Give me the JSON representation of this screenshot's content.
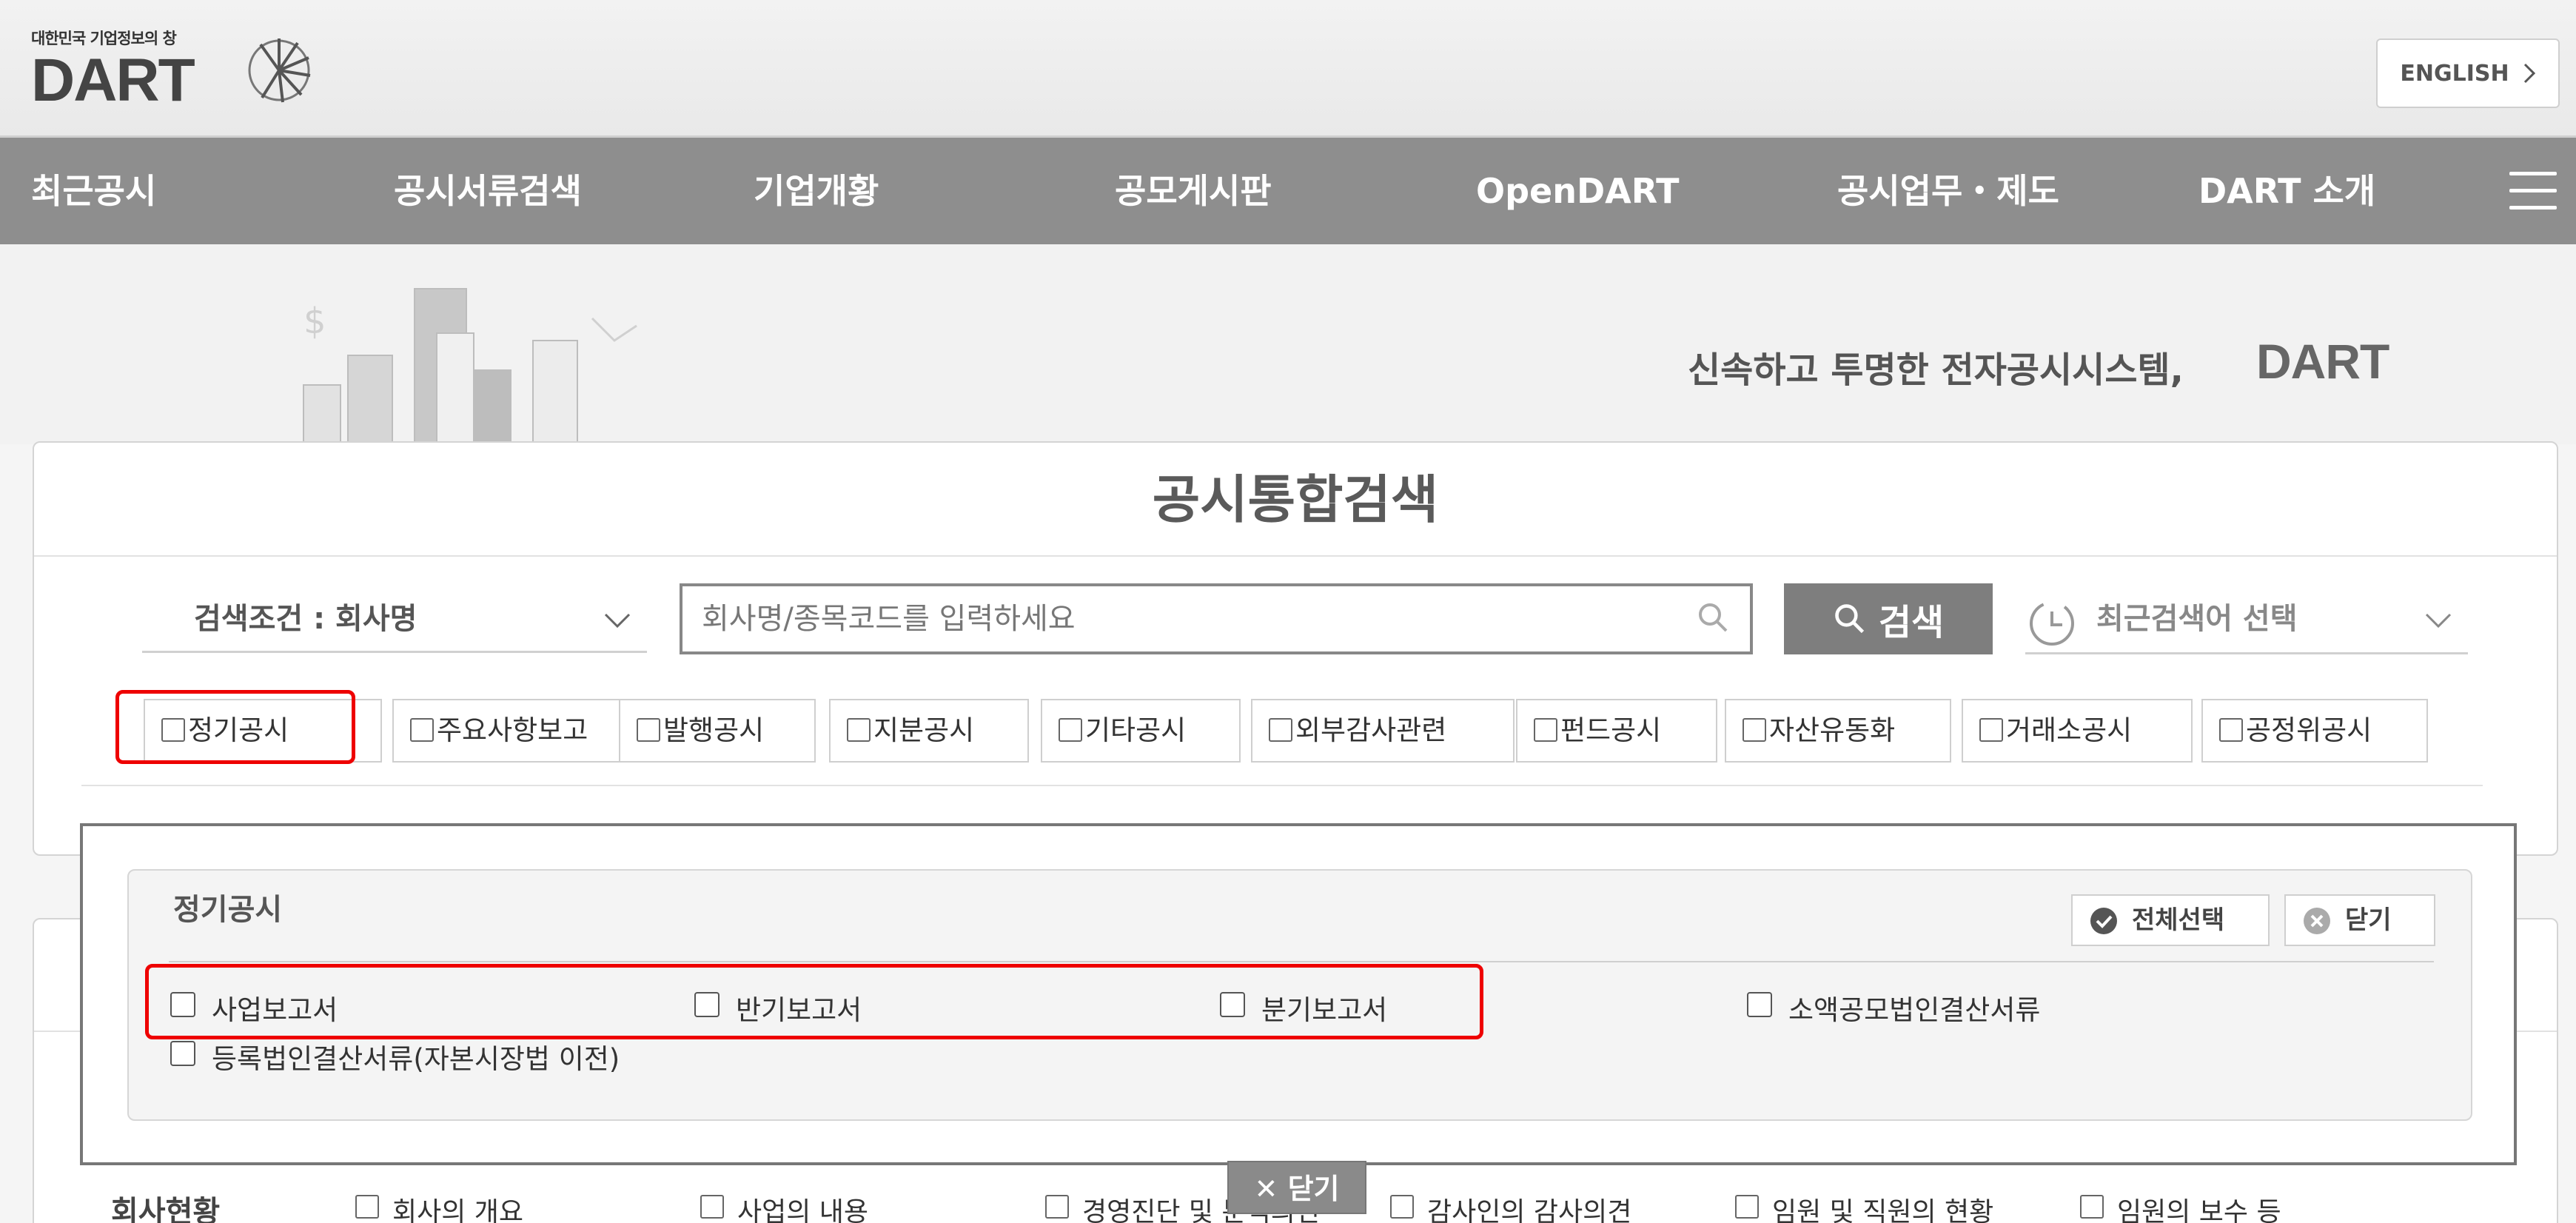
{
  "header": {
    "logo_sub": "대한민국 기업정보의 창",
    "logo_main": "DART",
    "english_label": "ENGLISH"
  },
  "nav": {
    "items": [
      "최근공시",
      "공시서류검색",
      "기업개황",
      "공모게시판",
      "OpenDART",
      "공시업무・제도",
      "DART 소개"
    ]
  },
  "banner": {
    "tagline": "신속하고 투명한 전자공시시스템,",
    "tagline_brand": "DART"
  },
  "search": {
    "title": "공시통합검색",
    "condition_label": "검색조건 : 회사명",
    "placeholder": "회사명/종목코드를 입력하세요",
    "button_label": "검색",
    "recent_label": "최근검색어 선택"
  },
  "tabs": [
    "정기공시",
    "주요사항보고",
    "발행공시",
    "지분공시",
    "기타공시",
    "외부감사관련",
    "펀드공시",
    "자산유동화",
    "거래소공시",
    "공정위공시"
  ],
  "popup": {
    "title": "정기공시",
    "select_all_label": "전체선택",
    "close_label": "닫기",
    "options": [
      "사업보고서",
      "반기보고서",
      "분기보고서",
      "소액공모법인결산서류",
      "등록법인결산서류(자본시장법 이전)"
    ],
    "bottom_close_label": "닫기"
  },
  "company_row": {
    "label": "회사현황",
    "items": [
      "회사의 개요",
      "사업의 내용",
      "경영진단 및 분석의견",
      "감사인의 감사의견",
      "임원 및 직원의 현황",
      "임원의 보수 등"
    ]
  },
  "colors": {
    "nav_bg": "#8e8e8e",
    "search_button": "#7e7e7e",
    "highlight": "#e00000"
  }
}
